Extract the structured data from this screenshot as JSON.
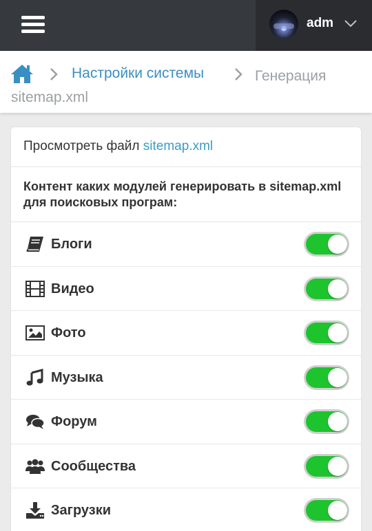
{
  "header": {
    "username": "adm",
    "menu_icon": "hamburger-menu-icon",
    "dropdown_icon": "chevron-down-icon"
  },
  "breadcrumbs": {
    "home_icon": "home-icon",
    "parent": "Настройки системы",
    "current": "Генерация sitemap.xml"
  },
  "card": {
    "view_prefix": "Просмотреть файл",
    "view_link": "sitemap.xml",
    "title": "Контент каких модулей генерировать в sitemap.xml для поисковых програм:",
    "items": [
      {
        "label": "Блоги",
        "icon": "book-icon",
        "enabled": true
      },
      {
        "label": "Видео",
        "icon": "film-icon",
        "enabled": true
      },
      {
        "label": "Фото",
        "icon": "image-icon",
        "enabled": true
      },
      {
        "label": "Музыка",
        "icon": "music-icon",
        "enabled": true
      },
      {
        "label": "Форум",
        "icon": "comments-icon",
        "enabled": true
      },
      {
        "label": "Сообщества",
        "icon": "users-icon",
        "enabled": true
      },
      {
        "label": "Загрузки",
        "icon": "download-icon",
        "enabled": true
      }
    ]
  },
  "colors": {
    "topbar": "#36393d",
    "link": "#3a8fc2",
    "toggle_on": "#1ec42d"
  }
}
